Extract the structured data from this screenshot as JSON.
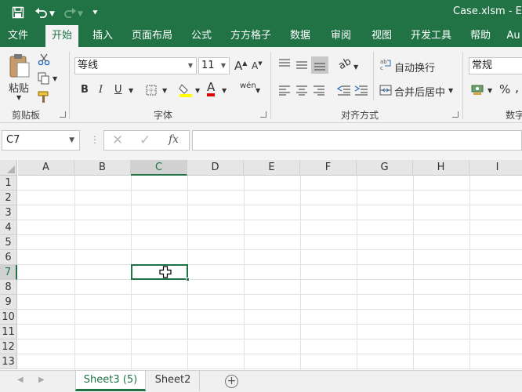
{
  "titlebar": {
    "title": "Case.xlsm - Excel",
    "save_icon": "save-icon",
    "undo_icon": "undo-icon",
    "redo_icon": "redo-icon",
    "customize_icon": "customize-qat-icon"
  },
  "tabs": [
    "文件",
    "开始",
    "插入",
    "页面布局",
    "公式",
    "方方格子",
    "数据",
    "审阅",
    "视图",
    "开发工具",
    "帮助",
    "Au"
  ],
  "active_tab": "开始",
  "ribbon": {
    "clipboard": {
      "label": "剪贴板",
      "paste": "粘贴"
    },
    "font": {
      "label": "字体",
      "font_name": "等线",
      "font_size": "11",
      "bold": "B",
      "italic": "I",
      "underline": "U",
      "font_color_letter": "A",
      "phonetic": "wén"
    },
    "alignment": {
      "label": "对齐方式",
      "wrap": "自动换行",
      "merge": "合并后居中"
    },
    "number": {
      "label": "数字",
      "format": "常规",
      "percent": "%"
    }
  },
  "formula_bar": {
    "name_box": "C7",
    "fx": "fx",
    "formula": ""
  },
  "grid": {
    "columns": [
      "A",
      "B",
      "C",
      "D",
      "E",
      "F",
      "G",
      "H",
      "I"
    ],
    "rows": [
      "1",
      "2",
      "3",
      "4",
      "5",
      "6",
      "7",
      "8",
      "9",
      "10",
      "11",
      "12",
      "13"
    ],
    "selected_cell": "C7",
    "selected_column": "C",
    "selected_row": "7"
  },
  "sheets": [
    "Sheet3 (5)",
    "Sheet2"
  ],
  "active_sheet": "Sheet3 (5)",
  "accent_color": "#217346"
}
